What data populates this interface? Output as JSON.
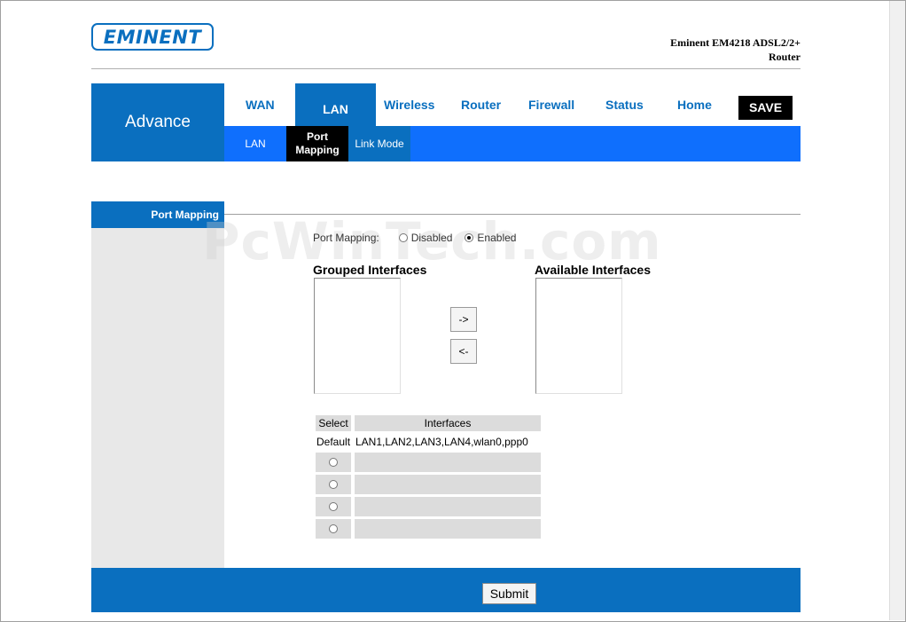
{
  "header": {
    "logo_text": "EMINENT",
    "model_line1": "Eminent EM4218 ADSL2/2+",
    "model_line2": "Router"
  },
  "section_label": "Advance",
  "nav": {
    "tabs": [
      "WAN",
      "LAN",
      "Wireless",
      "Router",
      "Firewall",
      "Status",
      "Home"
    ],
    "active": "LAN",
    "save_label": "SAVE"
  },
  "subnav": {
    "items": [
      "LAN",
      "Port Mapping",
      "Link Mode"
    ],
    "active": "Port Mapping"
  },
  "sidebar": {
    "title": "Port Mapping"
  },
  "watermark": "PcWinTech.com",
  "port_mapping": {
    "label": "Port Mapping:",
    "options": [
      "Disabled",
      "Enabled"
    ],
    "selected": "Enabled"
  },
  "grouped_interfaces": {
    "title": "Grouped Interfaces",
    "items": []
  },
  "available_interfaces": {
    "title": "Available Interfaces",
    "items": []
  },
  "move_buttons": {
    "right": "->",
    "left": "<-"
  },
  "groups_table": {
    "headers": [
      "Select",
      "Interfaces"
    ],
    "rows": [
      {
        "select": "Default",
        "interfaces": "LAN1,LAN2,LAN3,LAN4,wlan0,ppp0"
      },
      {
        "select": "",
        "interfaces": ""
      },
      {
        "select": "",
        "interfaces": ""
      },
      {
        "select": "",
        "interfaces": ""
      },
      {
        "select": "",
        "interfaces": ""
      }
    ]
  },
  "footer": {
    "submit_label": "Submit"
  },
  "colors": {
    "brand_blue": "#0a6fbf",
    "subnav_blue": "#0f6ffd",
    "active_black": "#000000"
  }
}
